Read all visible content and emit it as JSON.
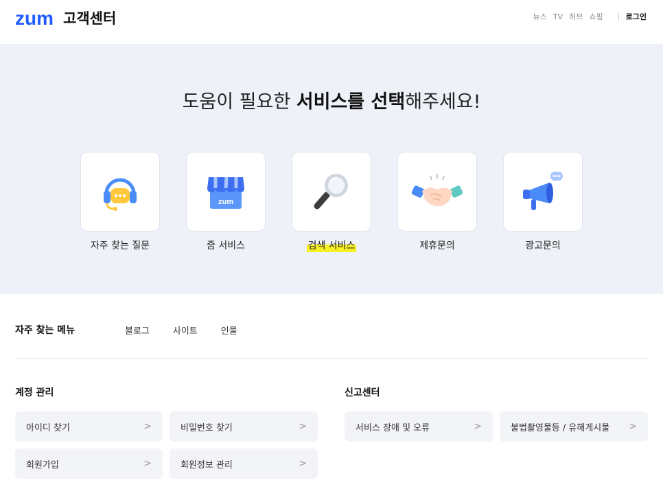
{
  "header": {
    "logo_text": "zum",
    "logo_sub": "고객센터",
    "nav": [
      "뉴스",
      "TV",
      "허브",
      "쇼핑"
    ],
    "login": "로그인",
    "brand_color": "#1f5bff"
  },
  "hero": {
    "title_pre": "도움이 필요한 ",
    "title_bold": "서비스를 선택",
    "title_post": "해주세요!",
    "services": [
      {
        "label": "자주 찾는 질문",
        "icon": "headset-icon"
      },
      {
        "label": "줌 서비스",
        "icon": "store-icon"
      },
      {
        "label": "검색 서비스",
        "icon": "magnifier-icon",
        "highlighted": true
      },
      {
        "label": "제휴문의",
        "icon": "handshake-icon"
      },
      {
        "label": "광고문의",
        "icon": "megaphone-icon"
      }
    ],
    "store_icon_text": "zum"
  },
  "frequent_menu": {
    "title": "자주 찾는 메뉴",
    "links": [
      "블로그",
      "사이트",
      "인물"
    ]
  },
  "account": {
    "title": "계정 관리",
    "items": [
      "아이디 찾기",
      "비밀번호 찾기",
      "회원가입",
      "회원정보 관리"
    ]
  },
  "report": {
    "title": "신고센터",
    "items": [
      "서비스 장애 및 오류",
      "불법촬영물등 / 유해게시물"
    ]
  },
  "chevron": ">"
}
